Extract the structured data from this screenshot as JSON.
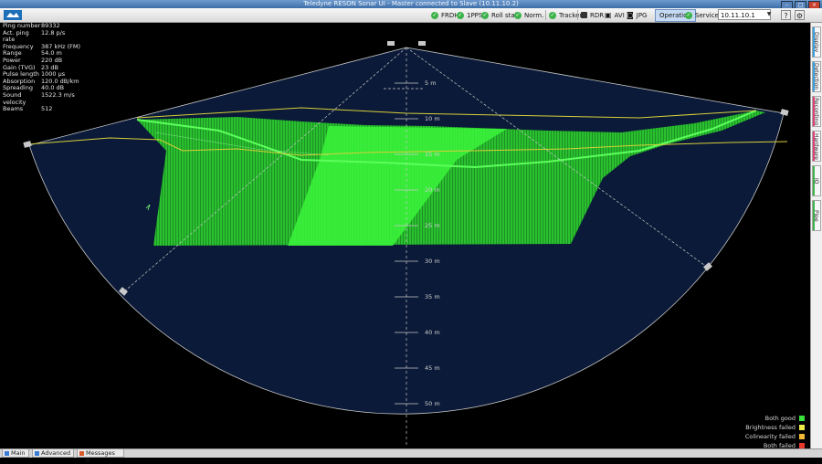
{
  "window": {
    "title": "Teledyne RESON Sonar UI - Master connected to Slave (10.11.10.2)"
  },
  "toolbar": {
    "status": [
      {
        "label": "FRDH",
        "icon": "check-icon"
      },
      {
        "label": "1PPS",
        "icon": "check-icon"
      },
      {
        "label": "Roll stab.",
        "icon": "check-icon"
      },
      {
        "label": "Norm.",
        "icon": "check-icon"
      },
      {
        "label": "Tracker",
        "icon": "check-icon"
      }
    ],
    "recording": [
      {
        "label": "RDR",
        "icon": "record-icon"
      },
      {
        "label": "AVI",
        "icon": "film-icon"
      },
      {
        "label": "JPG",
        "icon": "camera-icon"
      }
    ],
    "modes": [
      {
        "label": "Operation",
        "selected": true
      },
      {
        "label": "Service",
        "icon": "check-icon"
      }
    ],
    "ip_value": "10.11.10.1"
  },
  "info_panel": [
    {
      "label": "Ping number",
      "value": "89332"
    },
    {
      "label": "Act. ping rate",
      "value": "12.8 p/s"
    },
    {
      "label": "Frequency",
      "value": "387 kHz (FM)"
    },
    {
      "label": "Range",
      "value": "54.0 m"
    },
    {
      "label": "Power",
      "value": "220 dB"
    },
    {
      "label": "Gain (TVG)",
      "value": "23 dB"
    },
    {
      "label": "Pulse length",
      "value": "1000 µs"
    },
    {
      "label": "Absorption",
      "value": "120.0 dB/km"
    },
    {
      "label": "Spreading",
      "value": "40.0 dB"
    },
    {
      "label": "Sound velocity",
      "value": "1522.3 m/s"
    },
    {
      "label": "Beams",
      "value": "512"
    }
  ],
  "range_rings": [
    {
      "label": "5 m",
      "depth": 5
    },
    {
      "label": "10 m",
      "depth": 10
    },
    {
      "label": "15 m",
      "depth": 15
    },
    {
      "label": "20 m",
      "depth": 20
    },
    {
      "label": "25 m",
      "depth": 25
    },
    {
      "label": "30 m",
      "depth": 30
    },
    {
      "label": "35 m",
      "depth": 35
    },
    {
      "label": "40 m",
      "depth": 40
    },
    {
      "label": "45 m",
      "depth": 45
    },
    {
      "label": "50 m",
      "depth": 50
    }
  ],
  "legend": [
    {
      "label": "Both good",
      "color": "#37e23a"
    },
    {
      "label": "Brightness failed",
      "color": "#f0ec4a"
    },
    {
      "label": "Colinearity failed",
      "color": "#f5b936"
    },
    {
      "label": "Both failed",
      "color": "#e83a2c"
    }
  ],
  "side_tabs": [
    {
      "label": "Display",
      "color": "#3aa0e0"
    },
    {
      "label": "Detection",
      "color": "#3aa0e0"
    },
    {
      "label": "Recording",
      "color": "#e0407a"
    },
    {
      "label": "Hardware",
      "color": "#e0407a"
    },
    {
      "label": "IO",
      "color": "#3cb34a"
    },
    {
      "label": "Pipe",
      "color": "#3cb34a"
    }
  ],
  "bottom_tabs": [
    {
      "label": "Main",
      "color": "#3a7bd5"
    },
    {
      "label": "Advanced",
      "color": "#3a7bd5"
    },
    {
      "label": "Messages 0",
      "color": "#d95a2b"
    }
  ],
  "colors": {
    "water": "#0b1a38",
    "seafloor": "#2bdc2b",
    "bottom_line": "#d8d03a"
  }
}
